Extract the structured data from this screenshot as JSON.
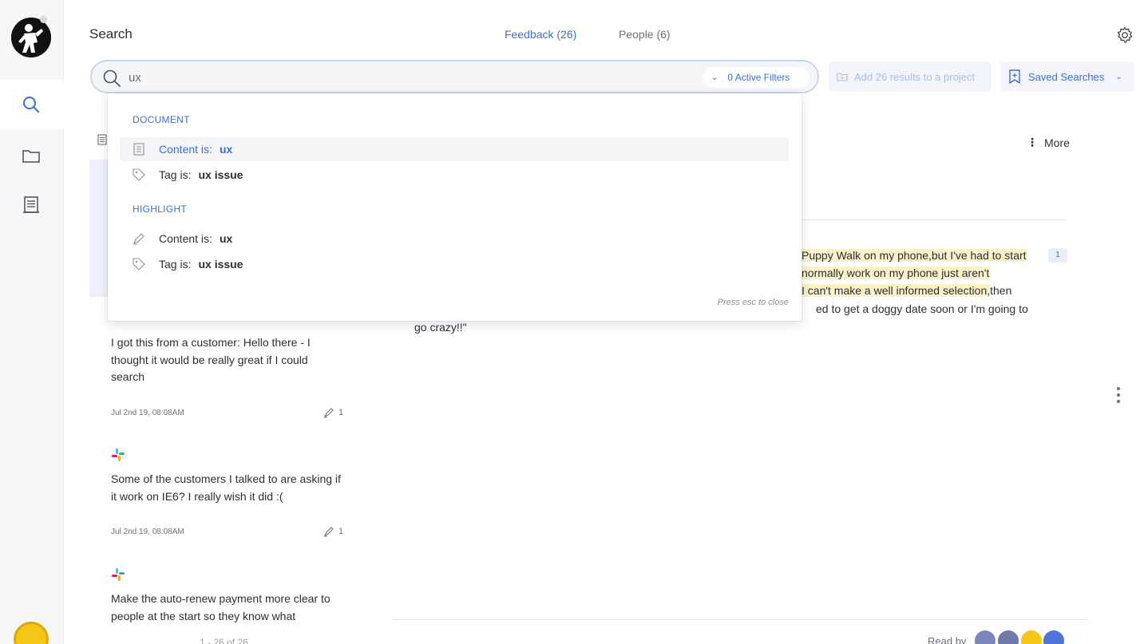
{
  "header": {
    "title": "Search",
    "tabs": [
      {
        "label": "Feedback (26)",
        "active": true
      },
      {
        "label": "People (6)",
        "active": false
      }
    ]
  },
  "search": {
    "value": "ux",
    "filters_label": "0 Active Filters",
    "add_results_label": "Add 26 results to a project",
    "saved_searches_label": "Saved Searches"
  },
  "dropdown": {
    "sections": [
      {
        "title": "DOCUMENT",
        "items": [
          {
            "label": "Content is:",
            "value": "ux",
            "icon": "document-icon",
            "active": true
          },
          {
            "label": "Tag is:",
            "value": "ux issue",
            "icon": "tag-icon",
            "active": false
          }
        ]
      },
      {
        "title": "HIGHLIGHT",
        "items": [
          {
            "label": "Content is:",
            "value": "ux",
            "icon": "highlighter-icon",
            "active": false
          },
          {
            "label": "Tag is:",
            "value": "ux issue",
            "icon": "tag-icon",
            "active": false
          }
        ]
      }
    ],
    "hint": "Press esc to close"
  },
  "feedback_list": [
    {
      "text": "I got this from a customer: Hello there - I thought it would be really great if I could search",
      "date": "Jul 2nd 19, 08:08AM",
      "highlight_count": "1"
    },
    {
      "text": "Some of the customers I talked to are asking if it work on IE6? I really wish it did :(",
      "date": "Jul 2nd 19, 08:08AM",
      "highlight_count": "1"
    },
    {
      "text": "Make the auto-renew payment more clear to people at the start so they know what"
    }
  ],
  "pager": "1 - 26 of 26",
  "detail": {
    "more_label": "More",
    "lines": [
      "Puppy Walk on my phone,but I've had to start",
      "normally work on my phone just aren't",
      "I can't make a well informed selection,",
      "then",
      "ed to get a doggy date soon or I'm going to",
      "go crazy!!\""
    ],
    "highlight_count": "1",
    "read_by_label": "Read by"
  },
  "colors": {
    "accent": "#3b6fd6",
    "highlight": "#fdf1c7"
  }
}
